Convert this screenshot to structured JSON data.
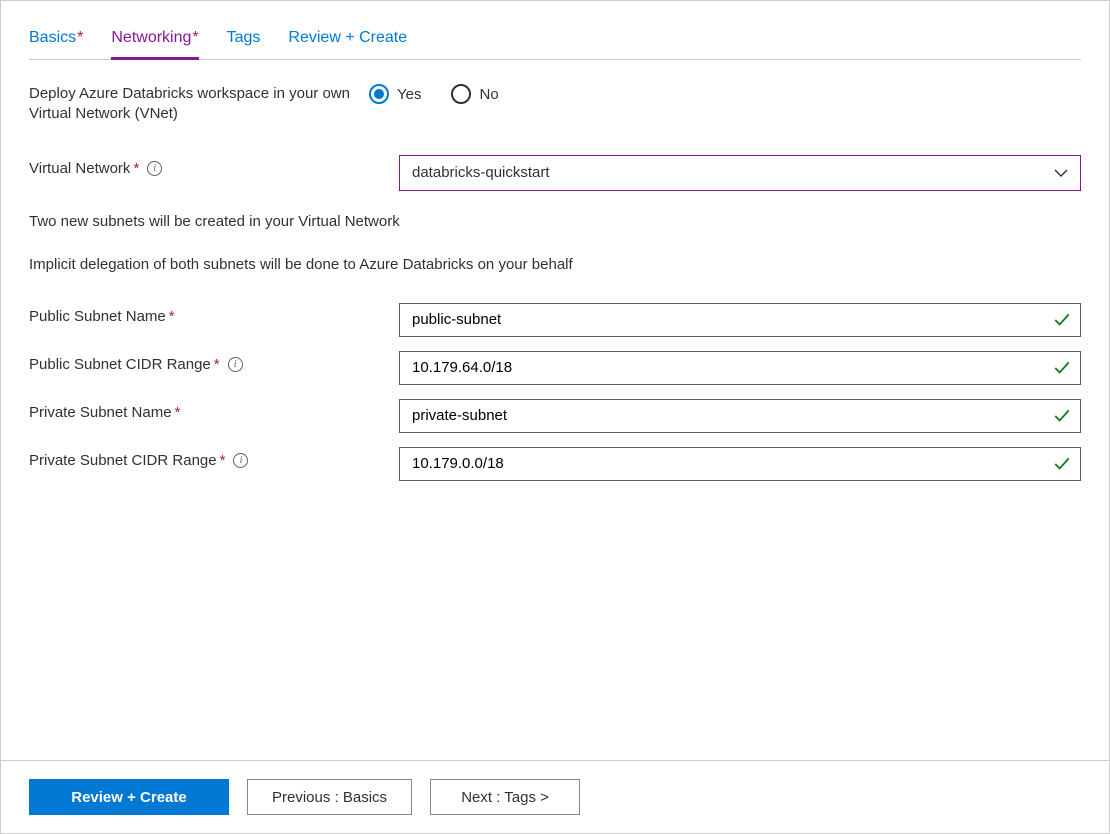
{
  "tabs": [
    {
      "label": "Basics",
      "required": true,
      "active": false
    },
    {
      "label": "Networking",
      "required": true,
      "active": true
    },
    {
      "label": "Tags",
      "required": false,
      "active": false
    },
    {
      "label": "Review + Create",
      "required": false,
      "active": false
    }
  ],
  "form": {
    "deploy_vnet": {
      "label": "Deploy Azure Databricks workspace in your own Virtual Network (VNet)",
      "yes": "Yes",
      "no": "No",
      "value": "Yes"
    },
    "virtual_network": {
      "label": "Virtual Network",
      "value": "databricks-quickstart"
    },
    "note1": "Two new subnets will be created in your Virtual Network",
    "note2": "Implicit delegation of both subnets will be done to Azure Databricks on your behalf",
    "public_subnet_name": {
      "label": "Public Subnet Name",
      "value": "public-subnet"
    },
    "public_subnet_cidr": {
      "label": "Public Subnet CIDR Range",
      "value": "10.179.64.0/18"
    },
    "private_subnet_name": {
      "label": "Private Subnet Name",
      "value": "private-subnet"
    },
    "private_subnet_cidr": {
      "label": "Private Subnet CIDR Range",
      "value": "10.179.0.0/18"
    }
  },
  "footer": {
    "review": "Review + Create",
    "previous": "Previous : Basics",
    "next": "Next : Tags >"
  }
}
